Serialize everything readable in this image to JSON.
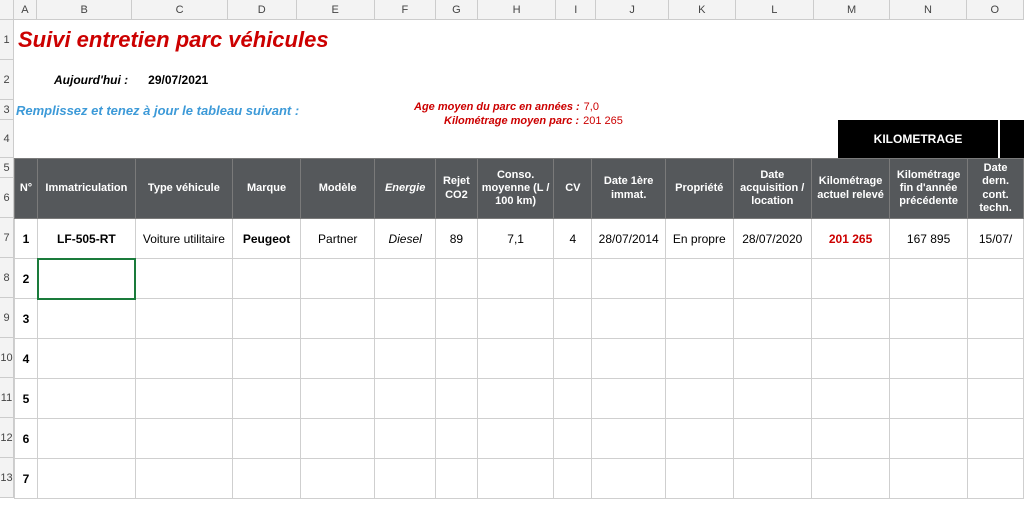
{
  "columns": [
    "A",
    "B",
    "C",
    "D",
    "E",
    "F",
    "G",
    "H",
    "I",
    "J",
    "K",
    "L",
    "M",
    "N",
    "O"
  ],
  "title": "Suivi entretien parc véhicules",
  "today_label": "Aujourd'hui :",
  "today_value": "29/07/2021",
  "instruction": "Remplissez et tenez à jour le tableau suivant :",
  "stats": {
    "line1_label": "Age moyen du parc en années :",
    "line1_value": "7,0",
    "line2_label": "Kilométrage moyen parc :",
    "line2_value": "201 265"
  },
  "section_header": "KILOMETRAGE",
  "table": {
    "headers": [
      "N°",
      "Immatriculation",
      "Type véhicule",
      "Marque",
      "Modèle",
      "Energie",
      "Rejet CO2",
      "Conso. moyenne (L / 100 km)",
      "CV",
      "Date 1ère immat.",
      "Propriété",
      "Date acquisition / location",
      "Kilométrage actuel relevé",
      "Kilométrage fin d'année précédente",
      "Date dern. cont. techn."
    ],
    "row_numbers": [
      "1",
      "2",
      "3",
      "4",
      "5",
      "6",
      "7"
    ],
    "rows": [
      {
        "n": "1",
        "immat": "LF-505-RT",
        "type": "Voiture utilitaire",
        "marque": "Peugeot",
        "modele": "Partner",
        "energie": "Diesel",
        "co2": "89",
        "conso": "7,1",
        "cv": "4",
        "date_immat": "28/07/2014",
        "propriete": "En propre",
        "date_acq": "28/07/2020",
        "km_actuel": "201 265",
        "km_prec": "167 895",
        "date_ct": "15/07/"
      }
    ]
  },
  "gutter_rows": [
    "1",
    "2",
    "3",
    "4",
    "5",
    "6",
    "7",
    "8",
    "9",
    "10",
    "11",
    "12",
    "13"
  ]
}
